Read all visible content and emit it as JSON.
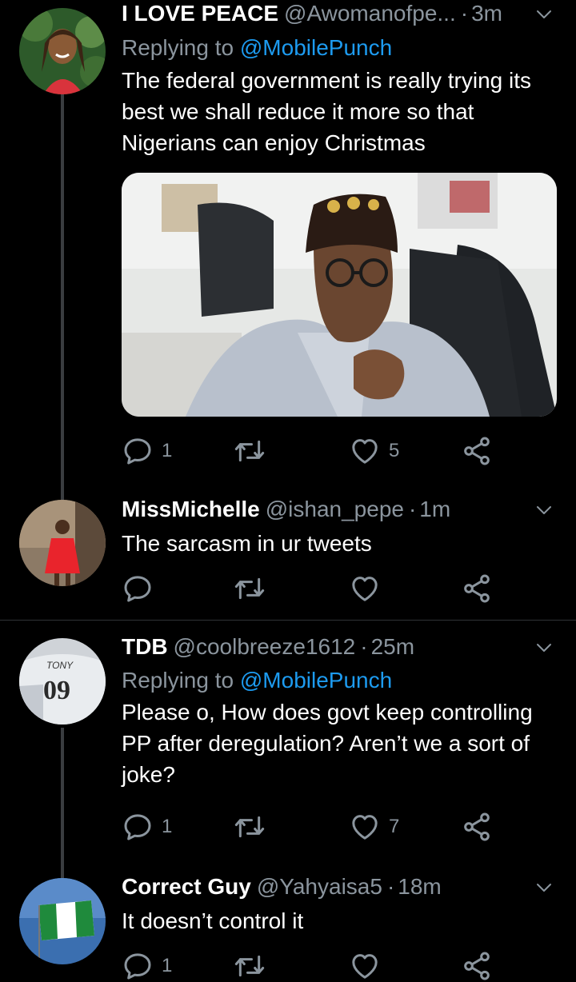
{
  "tweets": [
    {
      "name": "I LOVE PEACE",
      "handle": "@Awomanofpe...",
      "time": "3m",
      "replying_prefix": "Replying to",
      "replying_to": "@MobilePunch",
      "text": "The federal government is really trying its best we shall reduce it more so that Nigerians can enjoy Christmas",
      "reply_count": "1",
      "retweet_count": "",
      "like_count": "5"
    },
    {
      "name": "MissMichelle",
      "handle": "@ishan_pepe",
      "time": "1m",
      "text": "The sarcasm in ur tweets",
      "reply_count": "",
      "retweet_count": "",
      "like_count": ""
    },
    {
      "name": "TDB",
      "handle": "@coolbreeze1612",
      "time": "25m",
      "replying_prefix": "Replying to",
      "replying_to": "@MobilePunch",
      "text": "Please o, How does govt keep controlling PP after deregulation? Aren’t we a sort of joke?",
      "reply_count": "1",
      "retweet_count": "",
      "like_count": "7"
    },
    {
      "name": "Correct Guy",
      "handle": "@Yahyaisa5",
      "time": "18m",
      "text": "It doesn’t control it",
      "reply_count": "1",
      "retweet_count": "",
      "like_count": ""
    }
  ],
  "avatar_jersey_text": {
    "name": "TONY",
    "number": "09"
  },
  "colors": {
    "background": "#000000",
    "secondary_text": "#8b959e",
    "link": "#1d9bf0",
    "divider": "#2f3336"
  },
  "icons": [
    "reply-icon",
    "retweet-icon",
    "like-icon",
    "share-icon",
    "chevron-down-icon"
  ]
}
